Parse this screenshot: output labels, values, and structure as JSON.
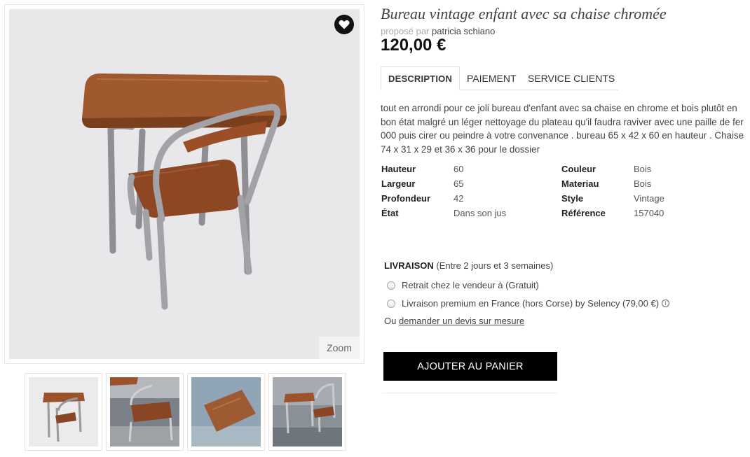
{
  "product": {
    "title": "Bureau vintage enfant avec sa chaise chromée",
    "proposed_label": "proposé par",
    "seller": "patricia schiano",
    "price": "120,00 €"
  },
  "gallery": {
    "zoom_label": "Zoom",
    "thumbnail_count": 4
  },
  "tabs": [
    {
      "label": "DESCRIPTION",
      "active": true
    },
    {
      "label": "PAIEMENT",
      "active": false
    },
    {
      "label": "SERVICE CLIENTS",
      "active": false
    }
  ],
  "description": "tout en arrondi pour ce joli bureau d'enfant avec sa chaise en chrome et bois plutôt en bon état malgré un léger nettoyage du plateau qu'il faudra raviver avec une paille de fer 000 puis cirer ou peindre à votre convenance . bureau 65 x 42 x 60 en hauteur . Chaise 74 x 31 x 29 et 36 x 36 pour le dossier",
  "specs": {
    "left": [
      {
        "key": "Hauteur",
        "value": "60"
      },
      {
        "key": "Largeur",
        "value": "65"
      },
      {
        "key": "Profondeur",
        "value": "42"
      },
      {
        "key": "État",
        "value": "Dans son jus"
      }
    ],
    "right": [
      {
        "key": "Couleur",
        "value": "Bois"
      },
      {
        "key": "Materiau",
        "value": "Bois"
      },
      {
        "key": "Style",
        "value": "Vintage"
      },
      {
        "key": "Référence",
        "value": "157040"
      }
    ]
  },
  "delivery": {
    "title": "LIVRAISON",
    "subtitle": "(Entre 2 jours et 3 semaines)",
    "options": [
      {
        "label": "Retrait chez le vendeur à (Gratuit)",
        "selected": false
      },
      {
        "label": "Livraison premium en France (hors Corse) by Selency (79,00 €)",
        "selected": false
      }
    ],
    "quote_prefix": "Ou",
    "quote_link": "demander un devis sur mesure"
  },
  "cart": {
    "button_label": "AJOUTER AU PANIER"
  },
  "colors": {
    "button_bg": "#000000",
    "image_bg": "#e8e8ea",
    "wood": "#a0562c",
    "chrome": "#9a9a9e"
  },
  "icons": [
    "heart-icon",
    "info-icon"
  ]
}
